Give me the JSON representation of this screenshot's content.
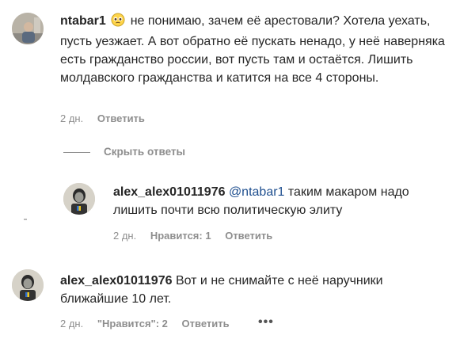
{
  "comments": [
    {
      "username": "ntabar1",
      "text": "не понимаю, зачем её арестовали? Хотела уехать, пусть уезжает. А вот обратно её пускать ненадо, у неё наверняка есть гражданство россии, вот пусть там и остаётся. Лишить молдавского гражданства и катится на все 4 стороны.",
      "time": "2 дн.",
      "reply_label": "Ответить",
      "emoji": "pleading-face-emoji"
    }
  ],
  "hide_replies_label": "Скрыть ответы",
  "replies": [
    {
      "username": "alex_alex01011976",
      "mention": "@ntabar1",
      "text": "таким макаром надо лишить почти всю политическую элиту",
      "time": "2 дн.",
      "likes_label": "Нравится: 1",
      "reply_label": "Ответить"
    }
  ],
  "comment2": {
    "username": "alex_alex01011976",
    "text": "Вот и не снимайте с неё наручники ближайшие 10 лет.",
    "time": "2 дн.",
    "likes_label": "\"Нравится\": 2",
    "reply_label": "Ответить",
    "more_label": "•••"
  }
}
